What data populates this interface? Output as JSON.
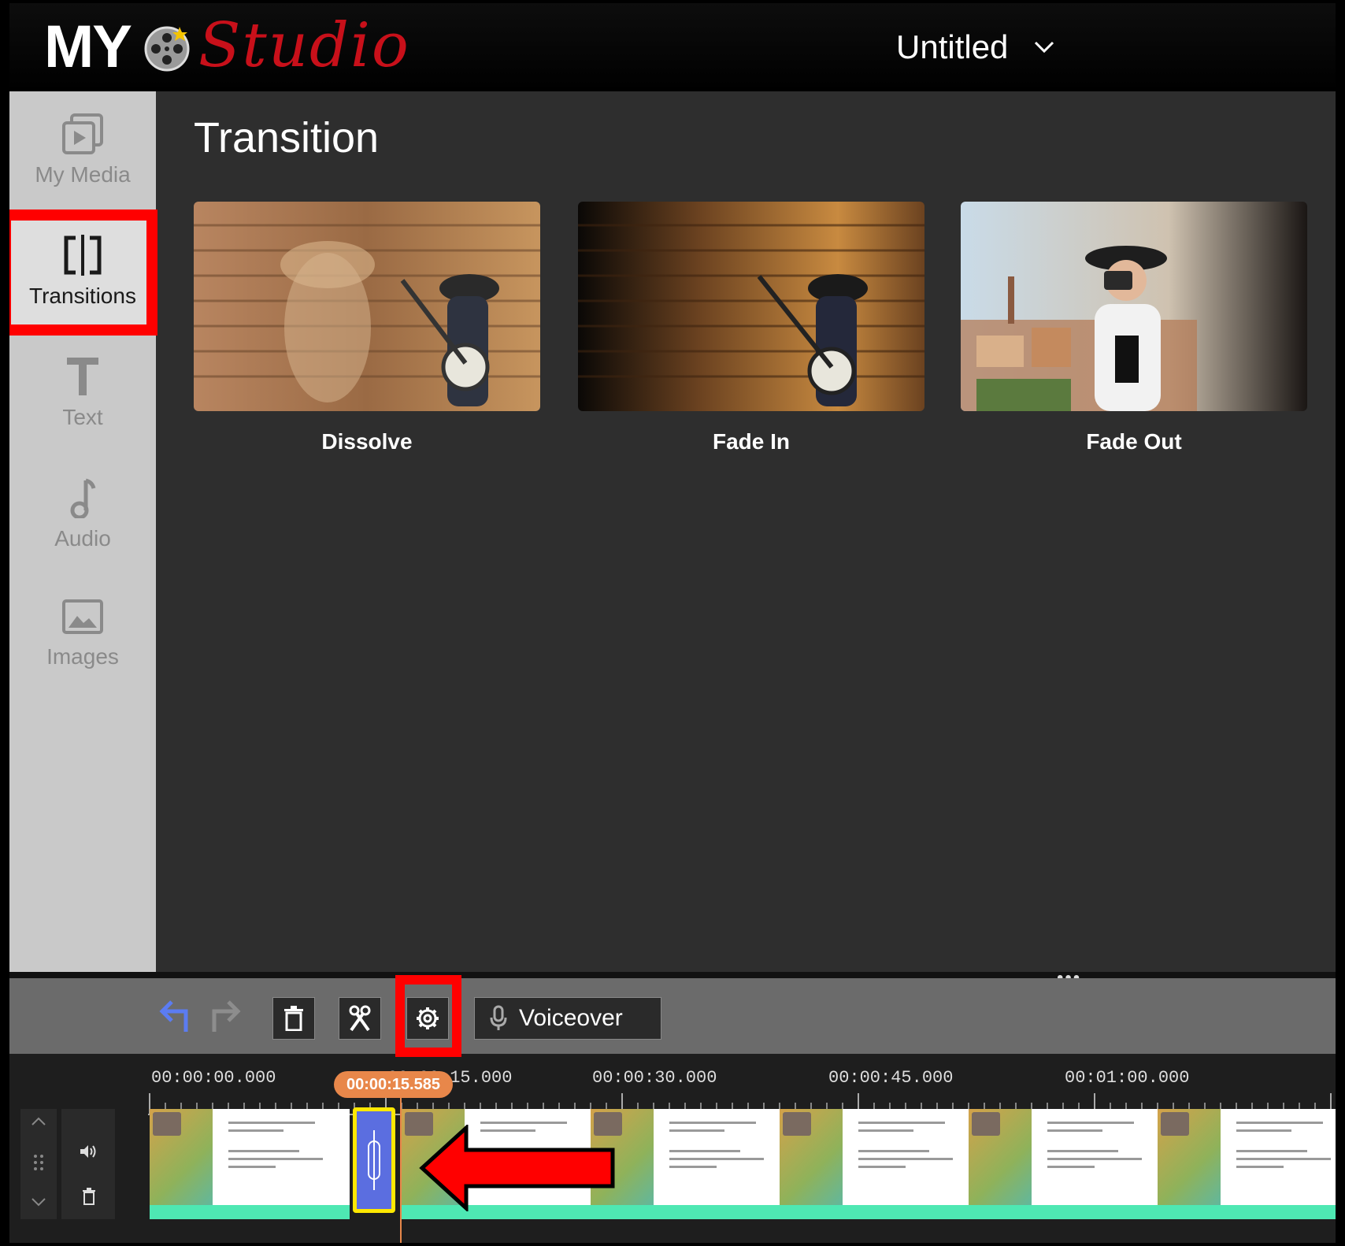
{
  "app": {
    "logo_my": "MY",
    "logo_studio": "Studio",
    "project_title": "Untitled"
  },
  "sidebar": {
    "items": [
      {
        "label": "My Media",
        "icon": "media-icon"
      },
      {
        "label": "Transitions",
        "icon": "transitions-icon",
        "active": true
      },
      {
        "label": "Text",
        "icon": "text-icon"
      },
      {
        "label": "Audio",
        "icon": "audio-icon"
      },
      {
        "label": "Images",
        "icon": "images-icon"
      }
    ]
  },
  "panel": {
    "title": "Transition",
    "cards": [
      {
        "label": "Dissolve"
      },
      {
        "label": "Fade In"
      },
      {
        "label": "Fade Out"
      }
    ]
  },
  "toolbar": {
    "voiceover_label": "Voiceover"
  },
  "timeline": {
    "ticks": [
      "00:00:00.000",
      "00:00:15.000",
      "00:00:30.000",
      "00:00:45.000",
      "00:01:00.000"
    ],
    "playhead": "00:00:15.585"
  },
  "colors": {
    "highlight": "#ff0000",
    "playhead": "#e8874a",
    "transition_block": "#5b6ee0",
    "clip_bar": "#4ee8b3"
  }
}
